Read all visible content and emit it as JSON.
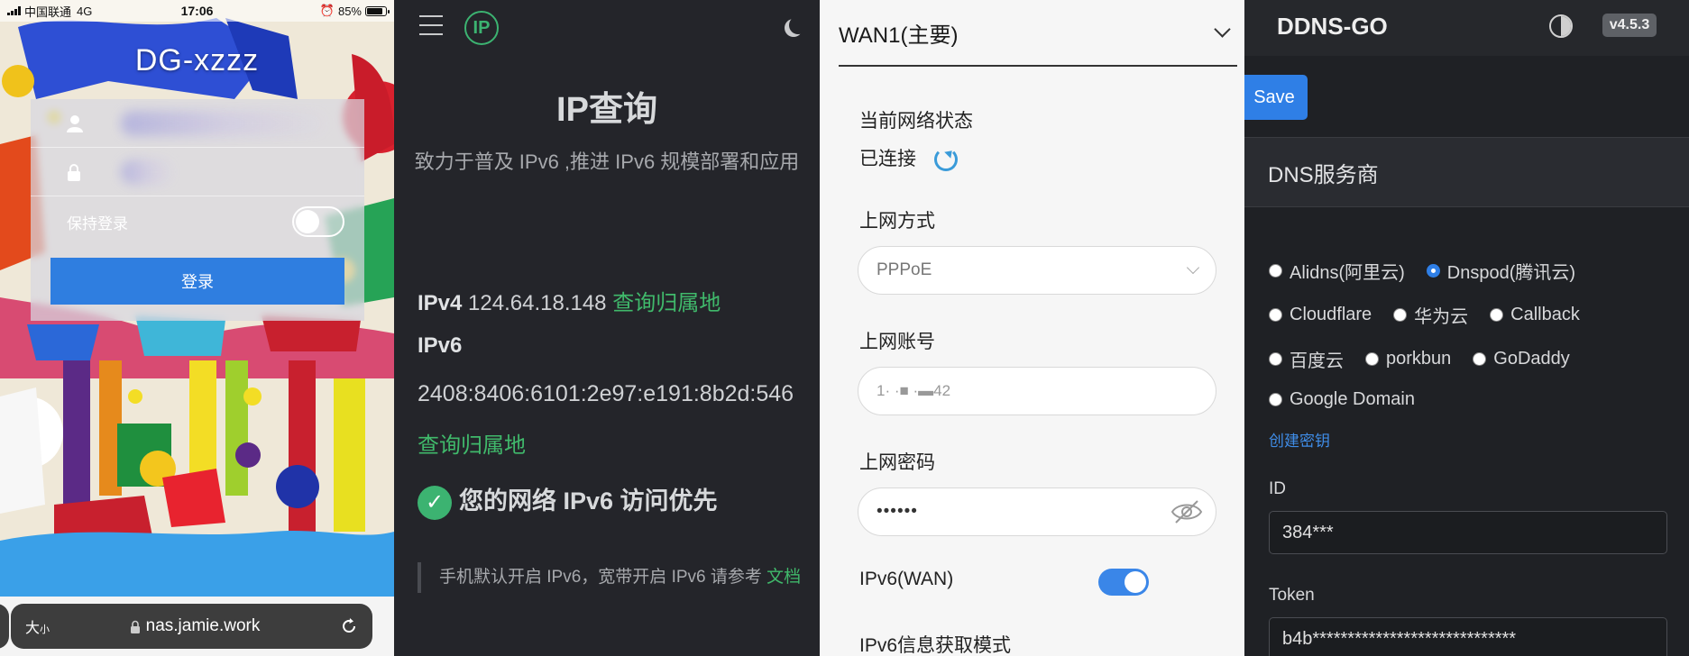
{
  "panel_login": {
    "status_bar": {
      "carrier": "中国联通",
      "network": "4G",
      "time": "17:06",
      "battery": "85%",
      "battery_level": 0.85
    },
    "title": "DG-xzzz",
    "remember_label": "保持登录",
    "login_button": "登录",
    "browser": {
      "text_size_label": "大",
      "text_size_small": "小",
      "url": "nas.jamie.work"
    }
  },
  "panel_ip": {
    "title": "IP查询",
    "subtitle": "致力于普及 IPv6 ,推进 IPv6 规模部署和应用",
    "ipv4_label": "IPv4",
    "ipv4_value": "124.64.18.148",
    "lookup_link": "查询归属地",
    "ipv6_label": "IPv6",
    "ipv6_value": "2408:8406:6101:2e97:e191:8b2d:546",
    "ipv6_lookup_link": "查询归属地",
    "priority_text": "您的网络 IPv6 访问优先",
    "notice_text": "手机默认开启 IPv6，宽带开启 IPv6 请参考",
    "notice_link": "文档"
  },
  "panel_router": {
    "wan_title": "WAN1(主要)",
    "status_label": "当前网络状态",
    "status_value": "已连接",
    "method_label": "上网方式",
    "method_value": "PPPoE",
    "account_label": "上网账号",
    "account_value": "1·  ·■     ·▬42",
    "password_label": "上网密码",
    "password_value": "••••••",
    "ipv6_wan_label": "IPv6(WAN)",
    "ipv6_mode_label": "IPv6信息获取模式"
  },
  "panel_ddns": {
    "brand": "DDNS-GO",
    "version": "v4.5.3",
    "save_button": "Save",
    "section_title": "DNS服务商",
    "providers": [
      {
        "label": "Alidns(阿里云)",
        "checked": false
      },
      {
        "label": "Dnspod(腾讯云)",
        "checked": true
      },
      {
        "label": "Cloudflare",
        "checked": false
      },
      {
        "label": "华为云",
        "checked": false
      },
      {
        "label": "Callback",
        "checked": false
      },
      {
        "label": "百度云",
        "checked": false
      },
      {
        "label": "porkbun",
        "checked": false
      },
      {
        "label": "GoDaddy",
        "checked": false
      },
      {
        "label": "Google Domain",
        "checked": false
      }
    ],
    "create_key_link": "创建密钥",
    "id_label": "ID",
    "id_value": "384***",
    "token_label": "Token",
    "token_value": "b4b*****************************"
  },
  "colors": {
    "accent_blue": "#2f7fe6",
    "green": "#40b96b",
    "dark_bg": "#24252a"
  }
}
